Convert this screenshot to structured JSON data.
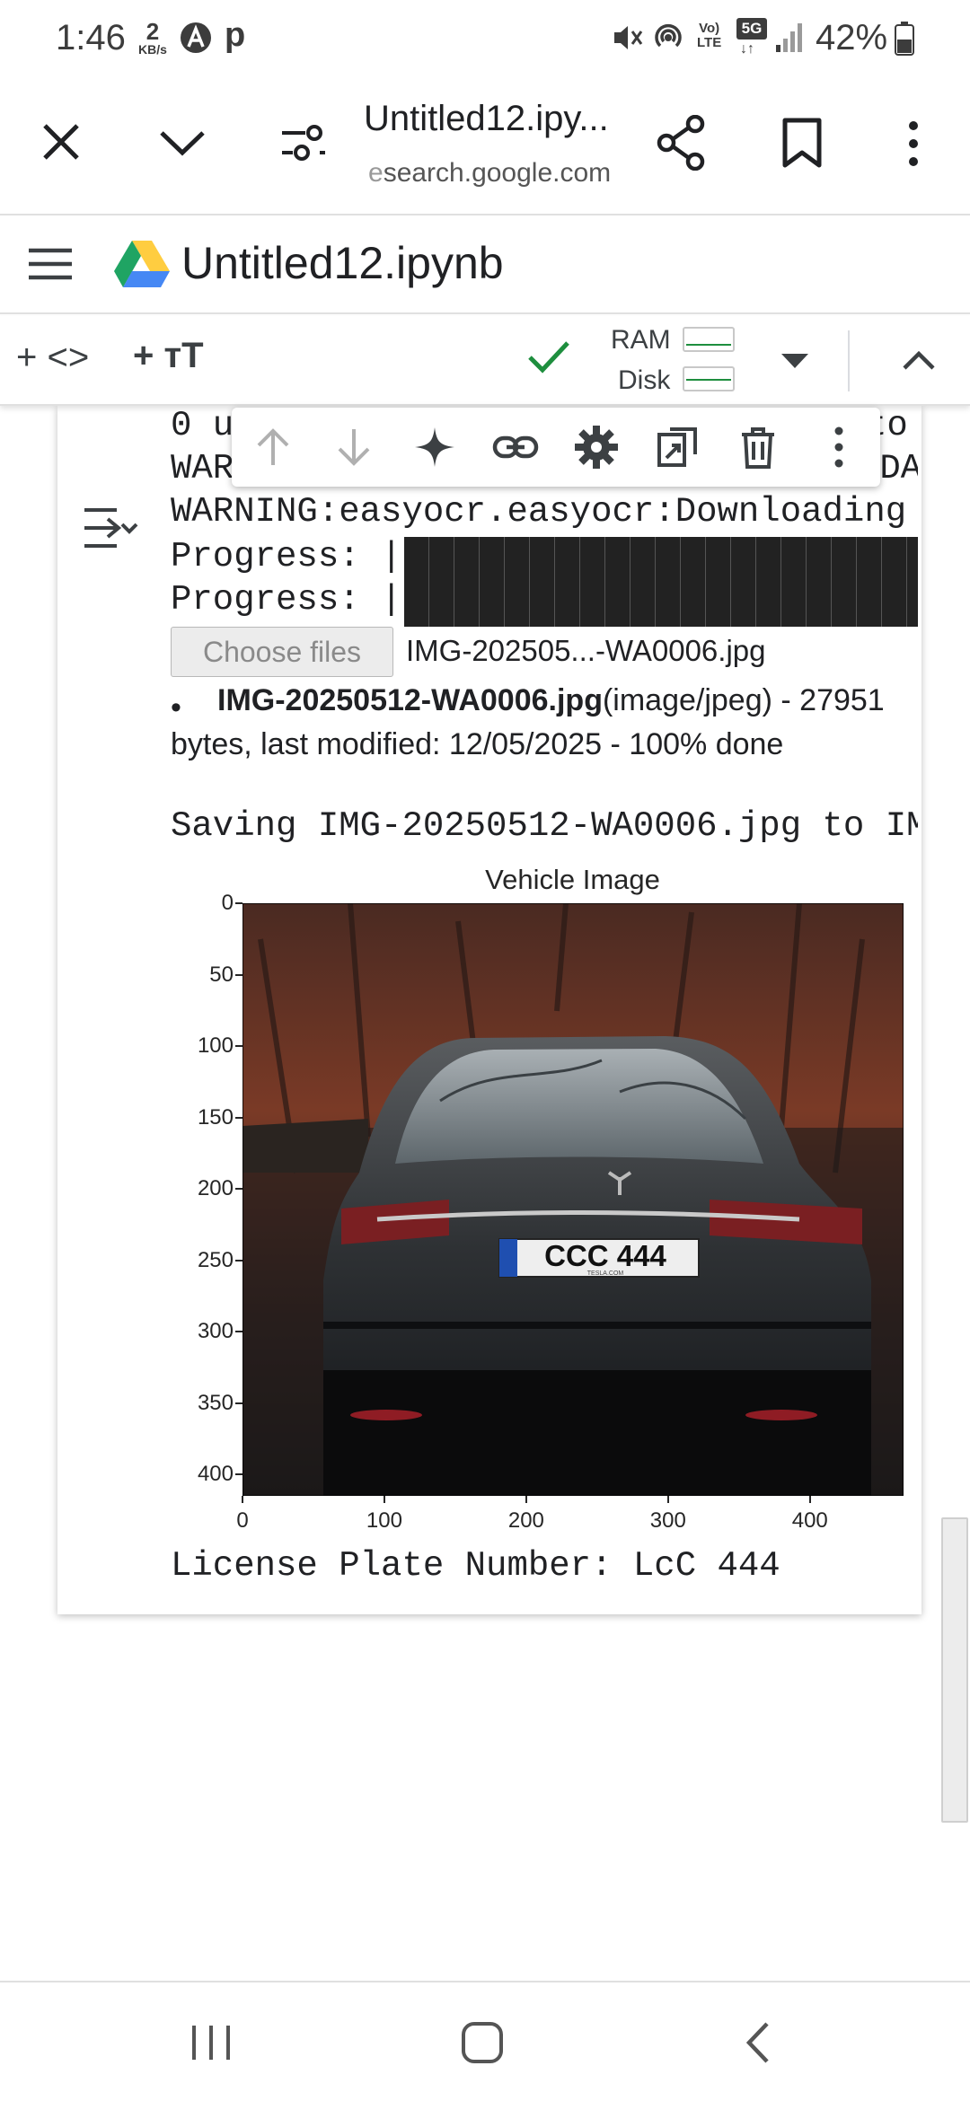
{
  "status_bar": {
    "time": "1:46",
    "net_speed_value": "2",
    "net_speed_unit": "KB/s",
    "app_letter": "P",
    "battery": "42%"
  },
  "browser": {
    "title": "Untitled12.ipy...",
    "url_prefix": "e",
    "url": "search.google.com"
  },
  "colab": {
    "notebook_title": "Untitled12.ipynb",
    "ram_label": "RAM",
    "disk_label": "Disk"
  },
  "output": {
    "line_0": "0 u",
    "line_0_tail": "to",
    "line_1": "WAR",
    "line_1_tail": "UDA",
    "line_2": "WARNING:easyocr.easyocr:Downloading",
    "progress_1": "Progress: |",
    "progress_2": "Progress: |",
    "choose_files": "Choose files",
    "selected_file": "IMG-202505...-WA0006.jpg",
    "file_name": "IMG-20250512-WA0006.jpg",
    "file_details": "(image/jpeg) - 27951 bytes, last modified: 12/05/2025 - 100% done",
    "saving": "Saving IMG-20250512-WA0006.jpg to IM",
    "plate_result": "License Plate Number: LcC 444"
  },
  "chart_data": {
    "type": "image",
    "title": "Vehicle Image",
    "y_ticks": [
      "0",
      "50",
      "100",
      "150",
      "200",
      "250",
      "300",
      "350",
      "400"
    ],
    "x_ticks": [
      "0",
      "100",
      "200",
      "300",
      "400"
    ],
    "xlim": [
      0,
      466
    ],
    "ylim": [
      415,
      0
    ],
    "plate_text": "CCC 444",
    "plate_subtext": "TESLA.COM"
  },
  "colors": {
    "check_green": "#1e8e3e",
    "drive_green": "#1fa463",
    "drive_yellow": "#ffcd40",
    "drive_blue": "#4688f4"
  }
}
